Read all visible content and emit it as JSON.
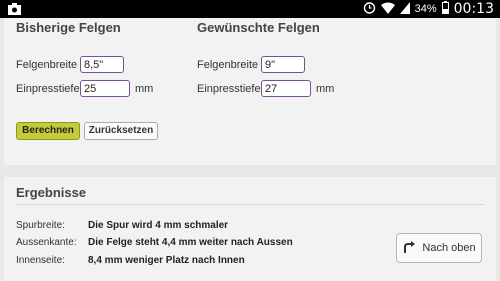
{
  "status": {
    "battery": "34%",
    "time": "00:13"
  },
  "current": {
    "heading": "Bisherige Felgen",
    "width_label": "Felgenbreite",
    "width_value": "8,5\"",
    "offset_label": "Einpresstiefe",
    "offset_value": "25",
    "unit": "mm"
  },
  "desired": {
    "heading": "Gewünschte Felgen",
    "width_label": "Felgenbreite",
    "width_value": "9\"",
    "offset_label": "Einpresstiefe",
    "offset_value": "27",
    "unit": "mm"
  },
  "buttons": {
    "calculate": "Berechnen",
    "reset": "Zurücksetzen"
  },
  "results": {
    "title": "Ergebnisse",
    "rows": [
      {
        "label": "Spurbreite:",
        "value": "Die Spur wird 4 mm schmaler"
      },
      {
        "label": "Aussenkante:",
        "value": "Die Felge steht 4,4 mm weiter nach Aussen"
      },
      {
        "label": "Innenseite:",
        "value": "8,4 mm weniger Platz nach Innen"
      }
    ],
    "top_button": "Nach oben"
  }
}
